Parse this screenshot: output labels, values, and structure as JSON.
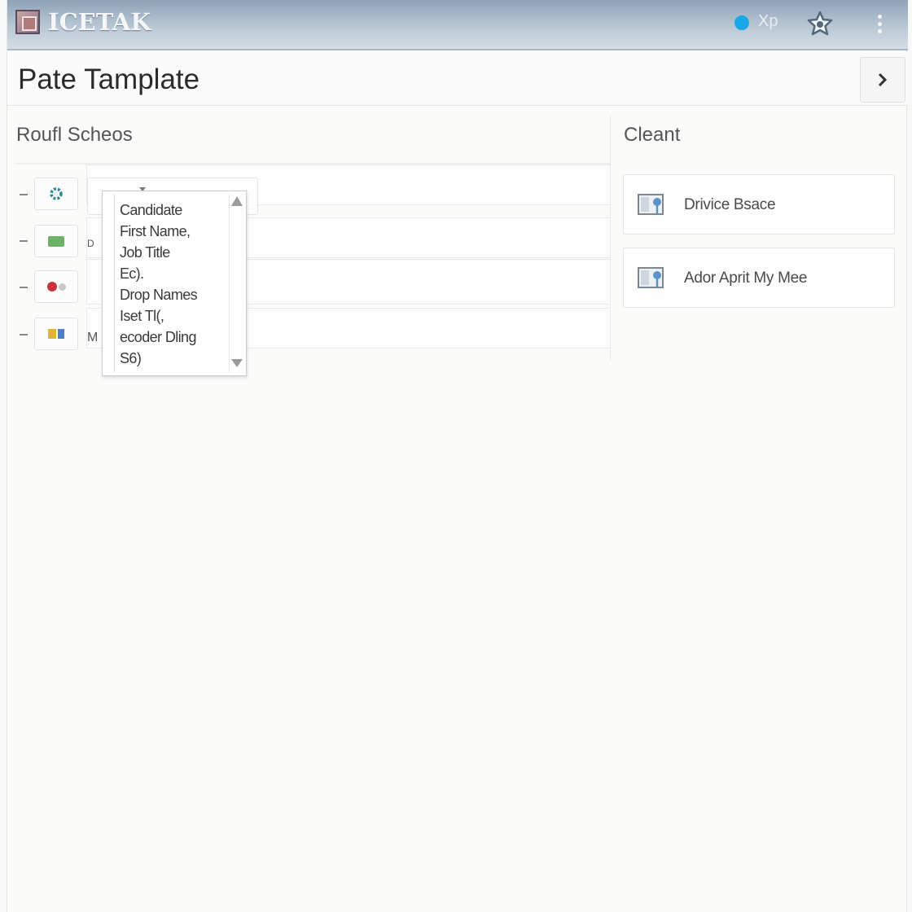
{
  "app": {
    "name": "ICETAK",
    "status_text": "Xp",
    "colors": {
      "status_dot": "#1aa7e8",
      "titlebar": "#a9b8c7"
    },
    "icons": {
      "logo": "app-logo-icon",
      "star": "star-icon",
      "menu": "kebab-menu-icon"
    }
  },
  "page": {
    "title": "Pate Tamplate",
    "next_icon": "chevron-right-icon"
  },
  "left_pane": {
    "title": "Roufl Scheos",
    "rows": [
      {
        "icon": "gear-icon",
        "field_text": ""
      },
      {
        "icon": "green-tag-icon",
        "field_text": "D"
      },
      {
        "icon": "red-dot-icon",
        "field_text": ""
      },
      {
        "icon": "yellow-blue-icon",
        "field_text": "M"
      }
    ]
  },
  "dropdown": {
    "items": [
      "Candidate",
      "First Name,",
      "Job Title",
      "Ес).",
      "Drop Names",
      "Iset Tl(,",
      "ecoder Dling",
      "S6)"
    ]
  },
  "right_pane": {
    "title": "Cleant",
    "cards": [
      {
        "label": "Drivice Bsace",
        "icon": "monitor-pin-icon"
      },
      {
        "label": "Ador Aprit My Mee",
        "icon": "monitor-pin-icon"
      }
    ]
  }
}
